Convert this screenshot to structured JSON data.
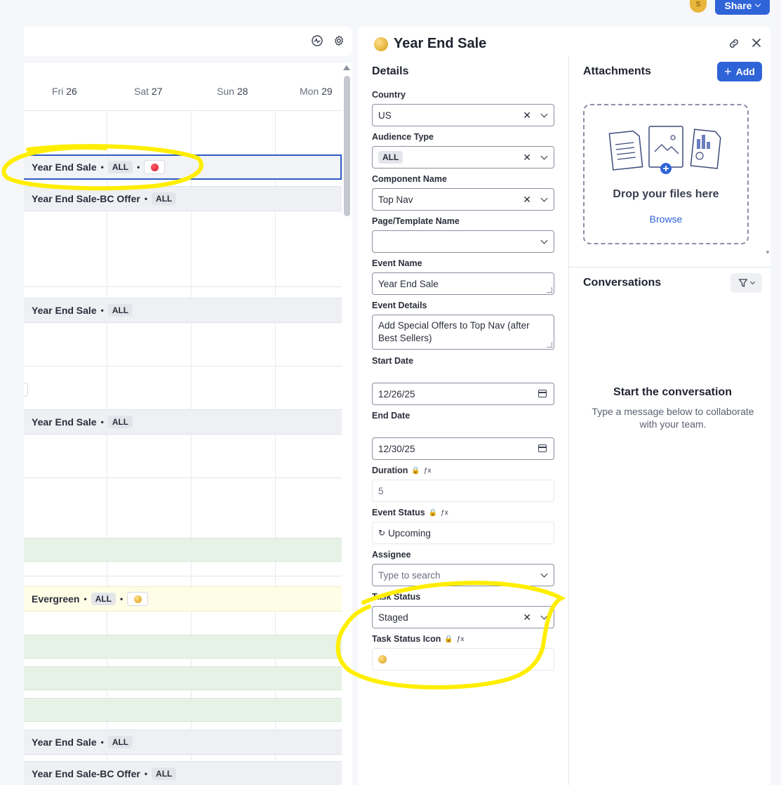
{
  "header": {
    "avatar_initial": "S",
    "share_label": "Share",
    "share_chevron": "⌄"
  },
  "calendar": {
    "days": [
      {
        "name": "Fri",
        "num": "26"
      },
      {
        "name": "Sat",
        "num": "27"
      },
      {
        "name": "Sun",
        "num": "28"
      },
      {
        "name": "Mon",
        "num": "29"
      }
    ],
    "events": [
      {
        "title": "Year End Sale",
        "pill": "ALL",
        "status_icon": "red-dot",
        "selected": true
      },
      {
        "title": "Year End Sale-BC Offer",
        "pill": "ALL"
      },
      {
        "title": "Year End Sale",
        "pill": "ALL"
      },
      {
        "title": "Year End Sale",
        "pill": "ALL"
      },
      {
        "title": "Evergreen",
        "pill": "ALL",
        "status_icon": "gold-dot"
      },
      {
        "title": "Year End Sale",
        "pill": "ALL"
      },
      {
        "title": "Year End Sale-BC Offer",
        "pill": "ALL"
      }
    ],
    "separator": "•"
  },
  "panel": {
    "title": "Year End Sale",
    "status_icon": "gold-dot",
    "details_heading": "Details",
    "fields": {
      "country": {
        "label": "Country",
        "value": "US"
      },
      "audience_type": {
        "label": "Audience Type",
        "value": "ALL"
      },
      "component_name": {
        "label": "Component Name",
        "value": "Top Nav"
      },
      "page_template": {
        "label": "Page/Template Name",
        "value": ""
      },
      "event_name": {
        "label": "Event Name",
        "value": "Year End Sale"
      },
      "event_details": {
        "label": "Event Details",
        "value": "Add Special Offers to Top Nav (after Best Sellers)"
      },
      "start_date": {
        "label": "Start Date",
        "value": "12/26/25"
      },
      "end_date": {
        "label": "End Date",
        "value": "12/30/25"
      },
      "duration": {
        "label": "Duration",
        "value": "5"
      },
      "event_status": {
        "label": "Event Status",
        "value": "Upcoming",
        "icon": "↻"
      },
      "assignee": {
        "label": "Assignee",
        "placeholder": "Type to search"
      },
      "task_status": {
        "label": "Task Status",
        "value": "Staged"
      },
      "task_status_icon": {
        "label": "Task Status Icon",
        "icon": "gold-dot"
      }
    },
    "lock_glyph": "🔒",
    "fx_glyph": "ƒx",
    "clear_glyph": "✕"
  },
  "attachments": {
    "heading": "Attachments",
    "add_label": "Add",
    "add_icon": "+",
    "drop_text": "Drop your files here",
    "browse_label": "Browse"
  },
  "conversations": {
    "heading": "Conversations",
    "empty_title": "Start the conversation",
    "empty_subtitle": "Type a message below to collaborate with your team."
  },
  "colors": {
    "accent": "#2f63d8",
    "highlight": "#ffee00",
    "selected_border": "#2d5bc5"
  }
}
